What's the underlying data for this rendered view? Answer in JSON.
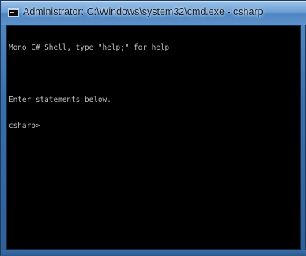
{
  "window": {
    "title": "Administrator: C:\\Windows\\system32\\cmd.exe - csharp",
    "icon": "console-icon"
  },
  "console": {
    "lines": [
      "Mono C# Shell, type \"help;\" for help",
      "",
      "Enter statements below.",
      "csharp>"
    ]
  }
}
